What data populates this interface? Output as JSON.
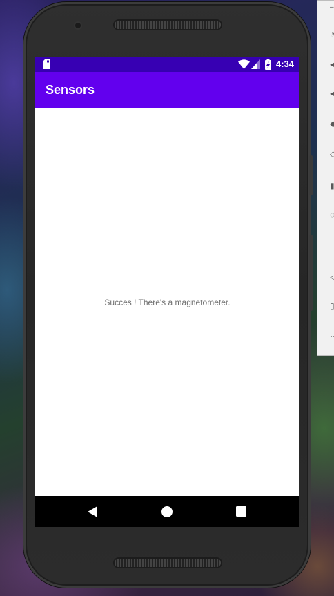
{
  "status_bar": {
    "time": "4:34",
    "icons": [
      "sd-card-icon",
      "wifi-icon",
      "cell-signal-icon",
      "battery-charging-icon"
    ]
  },
  "app_bar": {
    "title": "Sensors"
  },
  "main": {
    "message": "Succes ! There's a magnetometer."
  },
  "nav_bar": {
    "icons": [
      "back-icon",
      "home-icon",
      "recents-icon"
    ]
  },
  "colors": {
    "status_bar": "#3700b3",
    "app_bar": "#6200ee",
    "message_text": "#6f6f6f",
    "nav_bar": "#000000"
  }
}
